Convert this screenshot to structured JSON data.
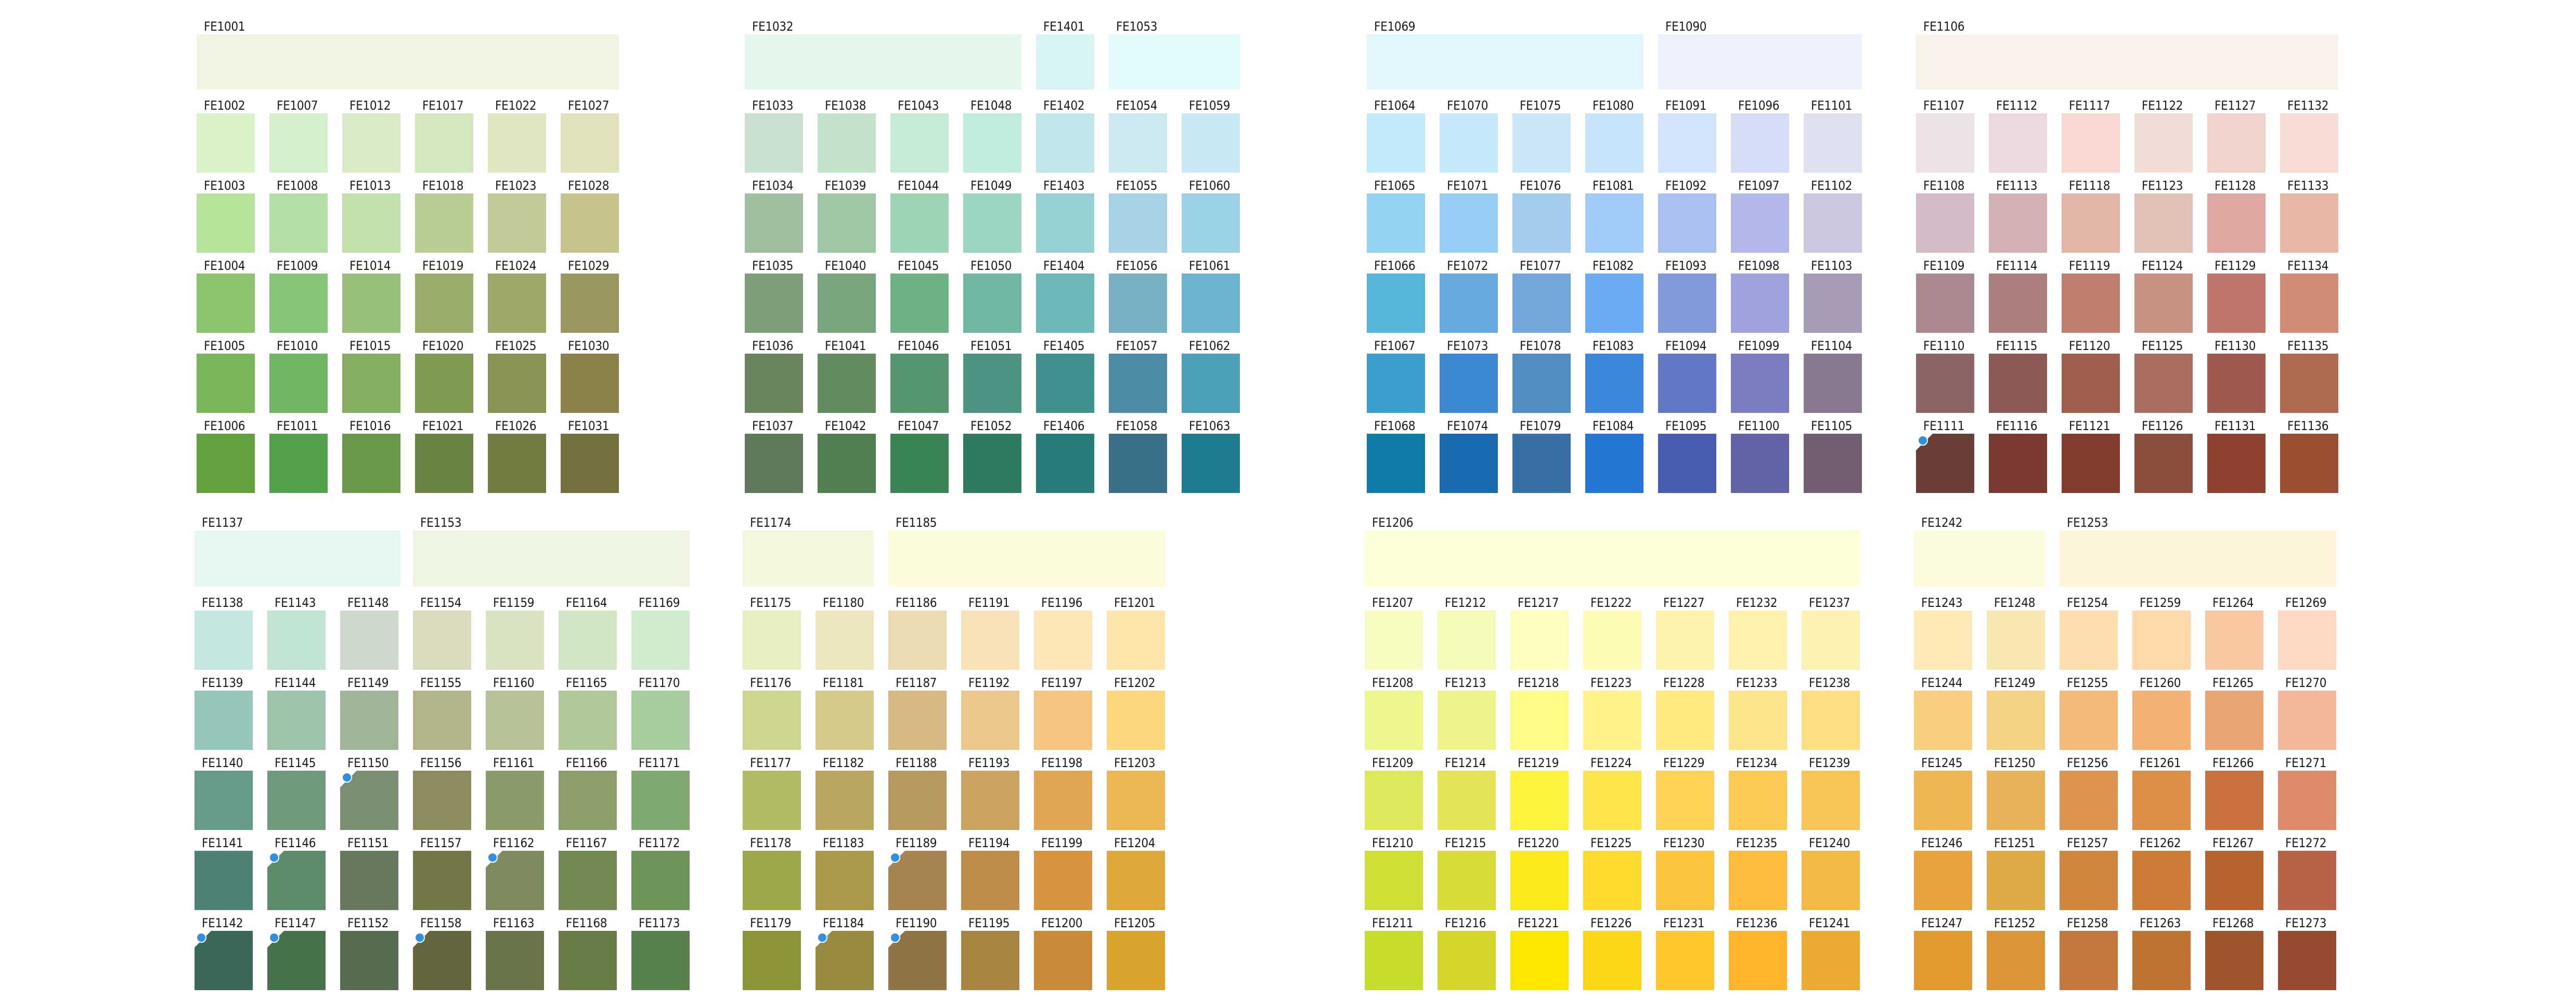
{
  "sheet": {
    "title": "",
    "sections": [
      {
        "id": "green-1",
        "wide": [
          {
            "code": "FE1001",
            "color": "#f0f6e1"
          }
        ],
        "columns": [
          [
            "FE1002",
            "FE1003",
            "FE1004",
            "FE1005",
            "FE1006"
          ],
          [
            "FE1007",
            "FE1008",
            "FE1009",
            "FE1010",
            "FE1011"
          ],
          [
            "FE1012",
            "FE1013",
            "FE1014",
            "FE1015",
            "FE1016"
          ],
          [
            "FE1017",
            "FE1018",
            "FE1019",
            "FE1020",
            "FE1021"
          ],
          [
            "FE1022",
            "FE1023",
            "FE1024",
            "FE1025",
            "FE1026"
          ],
          [
            "FE1027",
            "FE1028",
            "FE1029",
            "FE1030",
            "FE1031"
          ]
        ],
        "colors": [
          [
            "#d9f2c8",
            "#b8e39b",
            "#8cc46e",
            "#7ab65a",
            "#64a23f"
          ],
          [
            "#d5f0cf",
            "#b1dfa6",
            "#86c47a",
            "#6fb563",
            "#55a04a"
          ],
          [
            "#daecc7",
            "#c4e1ac",
            "#98c07a",
            "#86ae62",
            "#699848"
          ],
          [
            "#d4e8bd",
            "#b7cd92",
            "#98ae6a",
            "#7f9a52",
            "#6a8445"
          ],
          [
            "#dfe7c1",
            "#c3c996",
            "#9fa86a",
            "#8a9354",
            "#747c44"
          ],
          [
            "#e1e1bc",
            "#c6c38c",
            "#9c9662",
            "#8b8349",
            "#74713e"
          ]
        ]
      },
      {
        "id": "teal-1",
        "wide": [
          {
            "code": "FE1032",
            "color": "#e3f7ec"
          },
          {
            "code": "FE1401",
            "color": "#d8f3f3"
          },
          {
            "code": "FE1053",
            "color": "#e4fbfd"
          }
        ],
        "columns": [
          [
            "FE1033",
            "FE1034",
            "FE1035",
            "FE1036",
            "FE1037"
          ],
          [
            "FE1038",
            "FE1039",
            "FE1040",
            "FE1041",
            "FE1042"
          ],
          [
            "FE1043",
            "FE1044",
            "FE1045",
            "FE1046",
            "FE1047"
          ],
          [
            "FE1048",
            "FE1049",
            "FE1050",
            "FE1051",
            "FE1052"
          ],
          [
            "FE1402",
            "FE1403",
            "FE1404",
            "FE1405",
            "FE1406"
          ],
          [
            "FE1054",
            "FE1055",
            "FE1056",
            "FE1057",
            "FE1058"
          ],
          [
            "FE1059",
            "FE1060",
            "FE1061",
            "FE1062",
            "FE1063"
          ]
        ],
        "colors": [
          [
            "#c8e2cf",
            "#a2bea0",
            "#7f9c7b",
            "#6a8560",
            "#5f7a5a"
          ],
          [
            "#c3e2c9",
            "#9fc6a5",
            "#79a57f",
            "#638b62",
            "#517f52"
          ],
          [
            "#c4ebd4",
            "#9bd5b4",
            "#6eb186",
            "#56966e",
            "#3b8455"
          ],
          [
            "#c0ecdf",
            "#9dd5c3",
            "#6fb6a3",
            "#4c9584",
            "#2c7b62"
          ],
          [
            "#bfe7ea",
            "#97d0d3",
            "#6cb8b7",
            "#3f918e",
            "#267c76"
          ],
          [
            "#cde9f2",
            "#a6d3e5",
            "#78afc5",
            "#4e8ba7",
            "#3a7087"
          ],
          [
            "#c7e9f3",
            "#9cd2e5",
            "#6bb5cf",
            "#4ca1b9",
            "#1f7c8f"
          ]
        ]
      },
      {
        "id": "blue-1",
        "wide": [
          {
            "code": "FE1069",
            "color": "#e1f7fd"
          },
          {
            "code": "FE1090",
            "color": "#eef2fd"
          }
        ],
        "columns": [
          [
            "FE1064",
            "FE1065",
            "FE1066",
            "FE1067",
            "FE1068"
          ],
          [
            "FE1070",
            "FE1071",
            "FE1072",
            "FE1073",
            "FE1074"
          ],
          [
            "FE1075",
            "FE1076",
            "FE1077",
            "FE1078",
            "FE1079"
          ],
          [
            "FE1080",
            "FE1081",
            "FE1082",
            "FE1083",
            "FE1084"
          ],
          [
            "FE1091",
            "FE1092",
            "FE1093",
            "FE1094",
            "FE1095"
          ],
          [
            "FE1096",
            "FE1097",
            "FE1098",
            "FE1099",
            "FE1100"
          ],
          [
            "FE1101",
            "FE1102",
            "FE1103",
            "FE1104",
            "FE1105"
          ]
        ],
        "colors": [
          [
            "#c1ebfa",
            "#93d4f2",
            "#57b4da",
            "#3a9fcf",
            "#0f7ca8"
          ],
          [
            "#c6e8fb",
            "#97cdf5",
            "#66a9e0",
            "#3d8ad3",
            "#1a6ab0"
          ],
          [
            "#cbe6f7",
            "#a3cdee",
            "#73a7dc",
            "#508dc3",
            "#3870a6"
          ],
          [
            "#c8e4fb",
            "#9fcbf8",
            "#6aaaf0",
            "#3c86dc",
            "#2476d2"
          ],
          [
            "#d3e3fb",
            "#aac0f0",
            "#8199d8",
            "#6278c5",
            "#495db0"
          ],
          [
            "#d5dcf5",
            "#b2b8e8",
            "#9da1dc",
            "#7c7cc2",
            "#6363a7"
          ],
          [
            "#dfe1f0",
            "#cdc8dd",
            "#a79cb4",
            "#887890",
            "#735f73"
          ]
        ]
      },
      {
        "id": "red-1",
        "wide": [
          {
            "code": "FE1106",
            "color": "#f8f2eb"
          }
        ],
        "columns": [
          [
            "FE1107",
            "FE1108",
            "FE1109",
            "FE1110",
            "FE1111"
          ],
          [
            "FE1112",
            "FE1113",
            "FE1114",
            "FE1115",
            "FE1116"
          ],
          [
            "FE1117",
            "FE1118",
            "FE1119",
            "FE1120",
            "FE1121"
          ],
          [
            "FE1122",
            "FE1123",
            "FE1124",
            "FE1125",
            "FE1126"
          ],
          [
            "FE1127",
            "FE1128",
            "FE1129",
            "FE1130",
            "FE1131"
          ],
          [
            "FE1132",
            "FE1133",
            "FE1134",
            "FE1135",
            "FE1136"
          ]
        ],
        "colors": [
          [
            "#ebe1e6",
            "#d1bcc7",
            "#ac8991",
            "#8c6565",
            "#6b3d37"
          ],
          [
            "#ebd9dd",
            "#d4b1b4",
            "#ad7e7d",
            "#8e5a56",
            "#7a3a31"
          ],
          [
            "#f7d9d1",
            "#e2b5a8",
            "#c07e6c",
            "#a15d4d",
            "#833c2e"
          ],
          [
            "#f2ddd6",
            "#e1c2b9",
            "#c59181",
            "#a96e60",
            "#8b4e3c"
          ],
          [
            "#f0d3cd",
            "#dfa7a2",
            "#c0756a",
            "#a05a4d",
            "#8f4130"
          ],
          [
            "#f7ddd5",
            "#e8b6a4",
            "#d08b72",
            "#b06a50",
            "#9a4f33"
          ]
        ]
      },
      {
        "id": "green-2",
        "wide": [
          {
            "code": "FE1137",
            "color": "#e6f7ef"
          },
          {
            "code": "FE1153",
            "color": "#eef5e2"
          }
        ],
        "columns": [
          [
            "FE1138",
            "FE1139",
            "FE1140",
            "FE1141",
            "FE1142"
          ],
          [
            "FE1143",
            "FE1144",
            "FE1145",
            "FE1146",
            "FE1147"
          ],
          [
            "FE1148",
            "FE1149",
            "FE1150",
            "FE1151",
            "FE1152"
          ],
          [
            "FE1154",
            "FE1155",
            "FE1156",
            "FE1157",
            "FE1158"
          ],
          [
            "FE1159",
            "FE1160",
            "FE1161",
            "FE1162",
            "FE1163"
          ],
          [
            "FE1164",
            "FE1165",
            "FE1166",
            "FE1167",
            "FE1168"
          ],
          [
            "FE1169",
            "FE1170",
            "FE1171",
            "FE1172",
            "FE1173"
          ]
        ],
        "colors": [
          [
            "#c4e6e0",
            "#96c6b9",
            "#669b8c",
            "#4e8276",
            "#3a6a57"
          ],
          [
            "#c2e4d2",
            "#9dc3a8",
            "#6f9a7c",
            "#5d8c6b",
            "#44734c"
          ],
          [
            "#ccd8cc",
            "#a1b599",
            "#7a8f72",
            "#677a5e",
            "#566c51"
          ],
          [
            "#dbdcbf",
            "#b4b48a",
            "#8d8c5f",
            "#737645",
            "#65663d"
          ],
          [
            "#dae2c4",
            "#b6c296",
            "#8a9a69",
            "#7d8a5e",
            "#6a7449"
          ],
          [
            "#d1e5c7",
            "#b1c99a",
            "#8c9e69",
            "#728a52",
            "#687d45"
          ],
          [
            "#d1ebce",
            "#a9cba0",
            "#7fa970",
            "#6d9459",
            "#57804b"
          ]
        ]
      },
      {
        "id": "yellow-green",
        "wide": [
          {
            "code": "FE1174",
            "color": "#f2f8de"
          },
          {
            "code": "FE1185",
            "color": "#fcfcdc"
          }
        ],
        "columns": [
          [
            "FE1175",
            "FE1176",
            "FE1177",
            "FE1178",
            "FE1179"
          ],
          [
            "FE1180",
            "FE1181",
            "FE1182",
            "FE1183",
            "FE1184"
          ],
          [
            "FE1186",
            "FE1187",
            "FE1188",
            "FE1189",
            "FE1190"
          ],
          [
            "FE1191",
            "FE1192",
            "FE1193",
            "FE1194",
            "FE1195"
          ],
          [
            "FE1196",
            "FE1197",
            "FE1198",
            "FE1199",
            "FE1200"
          ],
          [
            "FE1201",
            "FE1202",
            "FE1203",
            "FE1204",
            "FE1205"
          ]
        ],
        "colors": [
          [
            "#e5efbf",
            "#cfd68d",
            "#b2bb62",
            "#9ea74b",
            "#8d9438"
          ],
          [
            "#ebe6bd",
            "#d5c988",
            "#b9a760",
            "#a99948",
            "#988a3c"
          ],
          [
            "#ebdbb2",
            "#d7b882",
            "#b79860",
            "#a7844f",
            "#917445"
          ],
          [
            "#f8e1b7",
            "#ecc88a",
            "#cda362",
            "#be8e48",
            "#a98441"
          ],
          [
            "#fde7b8",
            "#f6c581",
            "#e1a453",
            "#d79440",
            "#c98a3c"
          ],
          [
            "#fde4aa",
            "#fbd67c",
            "#edb853",
            "#e0a73a",
            "#d9a22b"
          ]
        ]
      },
      {
        "id": "yellow",
        "wide": [
          {
            "code": "FE1206",
            "color": "#fdfdd6"
          }
        ],
        "columns": [
          [
            "FE1207",
            "FE1208",
            "FE1209",
            "FE1210",
            "FE1211"
          ],
          [
            "FE1212",
            "FE1213",
            "FE1214",
            "FE1215",
            "FE1216"
          ],
          [
            "FE1217",
            "FE1218",
            "FE1219",
            "FE1220",
            "FE1221"
          ],
          [
            "FE1222",
            "FE1223",
            "FE1224",
            "FE1225",
            "FE1226"
          ],
          [
            "FE1227",
            "FE1228",
            "FE1229",
            "FE1230",
            "FE1231"
          ],
          [
            "FE1232",
            "FE1233",
            "FE1234",
            "FE1235",
            "FE1236"
          ],
          [
            "FE1237",
            "FE1238",
            "FE1239",
            "FE1240",
            "FE1241"
          ]
        ],
        "colors": [
          [
            "#f8fcc0",
            "#ecf68c",
            "#dde85a",
            "#cfdf36",
            "#c9dc2c"
          ],
          [
            "#f6fab8",
            "#eef38a",
            "#e2e656",
            "#d6dc3a",
            "#d3d72d"
          ],
          [
            "#feffbe",
            "#fefc86",
            "#fef33c",
            "#fdea1c",
            "#fde601"
          ],
          [
            "#fefbb5",
            "#fef288",
            "#fee54e",
            "#fedb2d",
            "#fdd617"
          ],
          [
            "#fef3ad",
            "#feea7e",
            "#fdd255",
            "#fcc43d",
            "#fec72c"
          ],
          [
            "#fef1ae",
            "#fde38b",
            "#fdca56",
            "#fcbc3e",
            "#feb52b"
          ],
          [
            "#fdf3b0",
            "#fedd83",
            "#f8c357",
            "#f2b947",
            "#ebaa33"
          ]
        ]
      },
      {
        "id": "orange",
        "wide": [
          {
            "code": "FE1242",
            "color": "#fdfbde"
          },
          {
            "code": "FE1253",
            "color": "#fdf4da"
          }
        ],
        "columns": [
          [
            "FE1243",
            "FE1244",
            "FE1245",
            "FE1246",
            "FE1247"
          ],
          [
            "FE1248",
            "FE1249",
            "FE1250",
            "FE1251",
            "FE1252"
          ],
          [
            "FE1254",
            "FE1255",
            "FE1256",
            "FE1257",
            "FE1258"
          ],
          [
            "FE1259",
            "FE1260",
            "FE1261",
            "FE1262",
            "FE1263"
          ],
          [
            "FE1264",
            "FE1265",
            "FE1266",
            "FE1267",
            "FE1268"
          ],
          [
            "FE1269",
            "FE1270",
            "FE1271",
            "FE1272",
            "FE1273"
          ]
        ],
        "colors": [
          [
            "#fdeab7",
            "#f8cf7f",
            "#f0b553",
            "#e9a33e",
            "#e19b31"
          ],
          [
            "#f7e7b1",
            "#f5d385",
            "#e6b35a",
            "#ddaa44",
            "#d99536"
          ],
          [
            "#fdddb0",
            "#f4b877",
            "#dc934f",
            "#d0863e",
            "#c2783b"
          ],
          [
            "#ffd9a9",
            "#f3b272",
            "#dc8d48",
            "#cc7b39",
            "#bd7331"
          ],
          [
            "#f7c8a1",
            "#eaa572",
            "#c9713f",
            "#b76431",
            "#a1552f"
          ],
          [
            "#fdd9c4",
            "#f2b899",
            "#dd8b6a",
            "#b8624a",
            "#984a31"
          ]
        ]
      }
    ],
    "ticks": [
      "FE1111",
      "FE1142",
      "FE1146",
      "FE1147",
      "FE1150",
      "FE1158",
      "FE1162",
      "FE1184",
      "FE1189",
      "FE1190"
    ]
  }
}
